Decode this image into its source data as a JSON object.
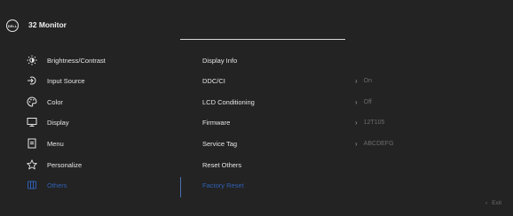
{
  "header": {
    "logo_text": "DELL",
    "title": "32 Monitor"
  },
  "menu": [
    {
      "label": "Brightness/Contrast",
      "icon": "brightness-icon",
      "active": false
    },
    {
      "label": "Input Source",
      "icon": "input-source-icon",
      "active": false
    },
    {
      "label": "Color",
      "icon": "color-palette-icon",
      "active": false
    },
    {
      "label": "Display",
      "icon": "display-icon",
      "active": false
    },
    {
      "label": "Menu",
      "icon": "menu-icon",
      "active": false
    },
    {
      "label": "Personalize",
      "icon": "star-icon",
      "active": false
    },
    {
      "label": "Others",
      "icon": "others-icon",
      "active": true
    }
  ],
  "others": [
    {
      "label": "Display Info",
      "value": ""
    },
    {
      "label": "DDC/CI",
      "value": "On"
    },
    {
      "label": "LCD Conditioning",
      "value": "Off"
    },
    {
      "label": "Firmware",
      "value": "12T105"
    },
    {
      "label": "Service Tag",
      "value": "ABCDEFG"
    },
    {
      "label": "Reset Others",
      "value": ""
    },
    {
      "label": "Factory Reset",
      "value": ""
    }
  ],
  "footer": {
    "exit_label": "Exit"
  },
  "colors": {
    "background": "#232323",
    "accent": "#2f5fb4",
    "text": "#e6e6e6",
    "muted": "#6c6c6c"
  }
}
